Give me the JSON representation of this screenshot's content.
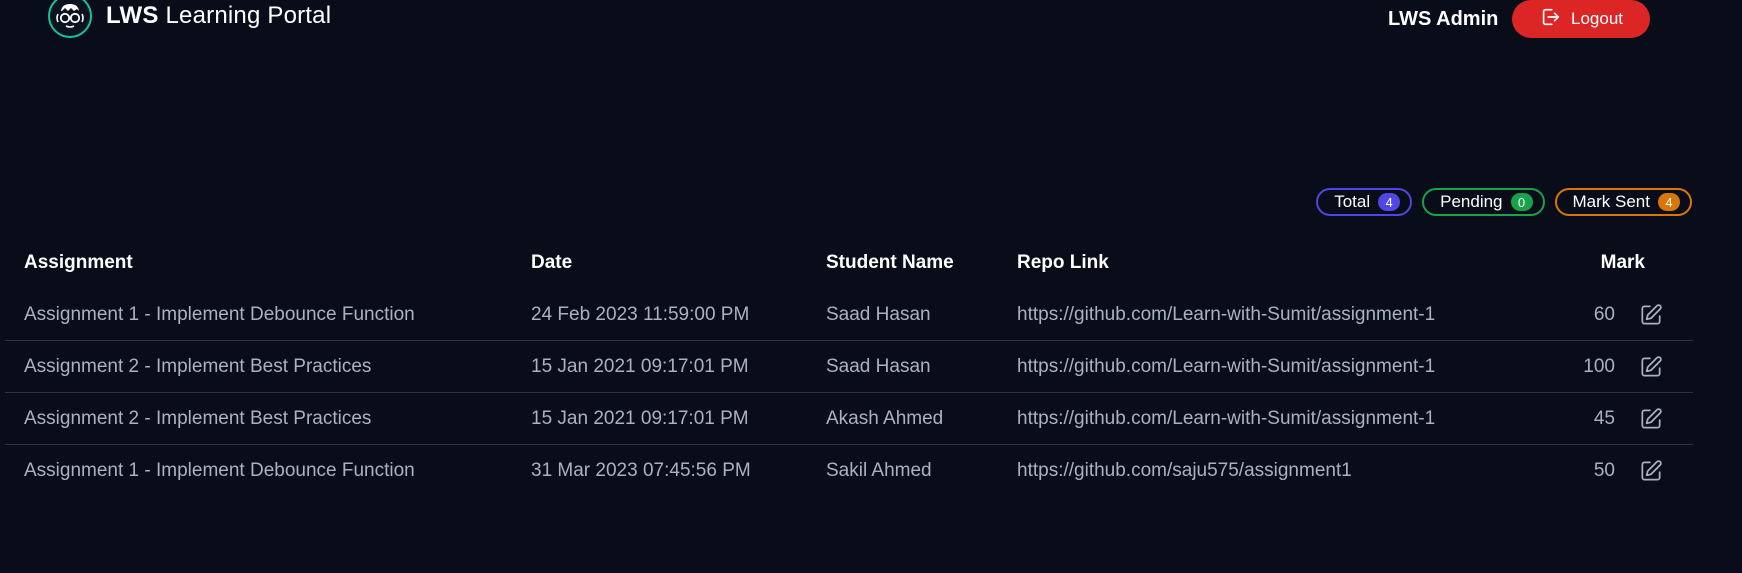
{
  "header": {
    "brand_bold": "LWS",
    "brand_rest": "Learning Portal",
    "admin_name": "LWS Admin",
    "logout_label": "Logout"
  },
  "stats": [
    {
      "label": "Total",
      "count": "4",
      "color": "#4f46e5"
    },
    {
      "label": "Pending",
      "count": "0",
      "color": "#16a34a"
    },
    {
      "label": "Mark Sent",
      "count": "4",
      "color": "#d97706"
    }
  ],
  "table": {
    "headers": [
      "Assignment",
      "Date",
      "Student Name",
      "Repo Link",
      "Mark"
    ],
    "rows": [
      {
        "assignment": "Assignment 1 - Implement Debounce Function",
        "date": "24 Feb 2023 11:59:00 PM",
        "student": "Saad Hasan",
        "repo": "https://github.com/Learn-with-Sumit/assignment-1",
        "mark": "60"
      },
      {
        "assignment": "Assignment 2 - Implement Best Practices",
        "date": "15 Jan 2021 09:17:01 PM",
        "student": "Saad Hasan",
        "repo": "https://github.com/Learn-with-Sumit/assignment-1",
        "mark": "100"
      },
      {
        "assignment": "Assignment 2 - Implement Best Practices",
        "date": "15 Jan 2021 09:17:01 PM",
        "student": "Akash Ahmed",
        "repo": "https://github.com/Learn-with-Sumit/assignment-1",
        "mark": "45"
      },
      {
        "assignment": "Assignment 1 - Implement Debounce Function",
        "date": "31 Mar 2023 07:45:56 PM",
        "student": "Sakil Ahmed",
        "repo": "https://github.com/saju575/assignment1",
        "mark": "50"
      }
    ]
  },
  "icons": {
    "logo": "nerd-face-glasses-icon",
    "logout": "logout-door-icon",
    "edit": "edit-pencil-square-icon"
  },
  "colors": {
    "background": "#080d19",
    "logout_bg": "#dc2626",
    "logo_ring": "#19c39a"
  }
}
